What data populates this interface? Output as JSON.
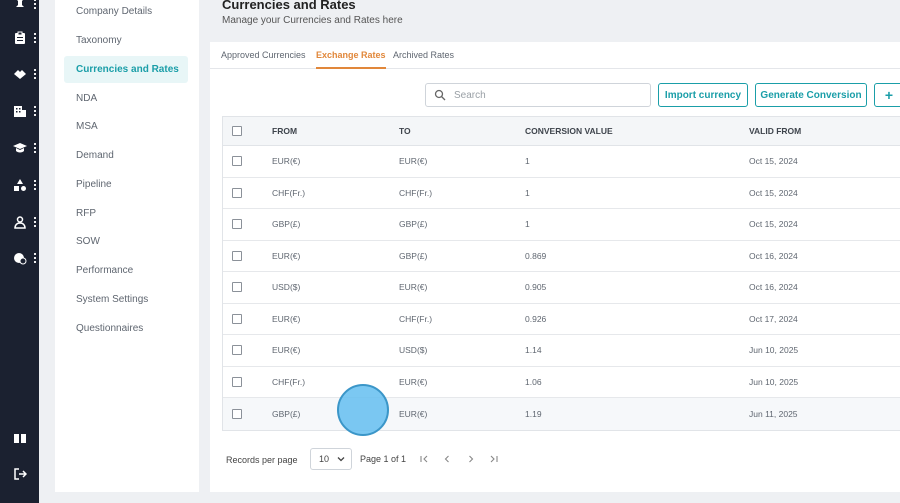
{
  "rail": {
    "icons": [
      "pin-icon",
      "clipboard-icon",
      "handshake-icon",
      "building-icon",
      "graduation-cap-icon",
      "shapes-icon",
      "user-icon",
      "settings-badge-icon",
      "book-icon",
      "logout-icon"
    ]
  },
  "subnav": {
    "items": [
      {
        "label": "Company Details"
      },
      {
        "label": "Taxonomy"
      },
      {
        "label": "Currencies and Rates",
        "active": true
      },
      {
        "label": "NDA"
      },
      {
        "label": "MSA"
      },
      {
        "label": "Demand"
      },
      {
        "label": "Pipeline"
      },
      {
        "label": "RFP"
      },
      {
        "label": "SOW"
      },
      {
        "label": "Performance"
      },
      {
        "label": "System Settings"
      },
      {
        "label": "Questionnaires"
      }
    ]
  },
  "header": {
    "title": "Currencies and Rates",
    "subtitle": "Manage your Currencies and Rates here"
  },
  "tabs": [
    {
      "label": "Approved Currencies"
    },
    {
      "label": "Exchange Rates",
      "active": true
    },
    {
      "label": "Archived Rates"
    }
  ],
  "toolbar": {
    "search_placeholder": "Search",
    "import_label": "Import currency",
    "generate_label": "Generate Conversion",
    "add_label": "+"
  },
  "table": {
    "columns": [
      "FROM",
      "TO",
      "CONVERSION VALUE",
      "VALID FROM"
    ],
    "rows": [
      [
        "EUR(€)",
        "EUR(€)",
        "1",
        "Oct 15, 2024"
      ],
      [
        "CHF(Fr.)",
        "CHF(Fr.)",
        "1",
        "Oct 15, 2024"
      ],
      [
        "GBP(£)",
        "GBP(£)",
        "1",
        "Oct 15, 2024"
      ],
      [
        "EUR(€)",
        "GBP(£)",
        "0.869",
        "Oct 16, 2024"
      ],
      [
        "USD($)",
        "EUR(€)",
        "0.905",
        "Oct 16, 2024"
      ],
      [
        "EUR(€)",
        "CHF(Fr.)",
        "0.926",
        "Oct 17, 2024"
      ],
      [
        "EUR(€)",
        "USD($)",
        "1.14",
        "Jun 10, 2025"
      ],
      [
        "CHF(Fr.)",
        "EUR(€)",
        "1.06",
        "Jun 10, 2025"
      ],
      [
        "GBP(£)",
        "EUR(€)",
        "1.19",
        "Jun 11, 2025"
      ]
    ]
  },
  "pagination": {
    "records_label": "Records per page",
    "per_page": "10",
    "page_label": "Page 1 of 1"
  },
  "colors": {
    "accent": "#1a9ea8",
    "tab_active": "#e1873a",
    "rail": "#1b2130"
  }
}
